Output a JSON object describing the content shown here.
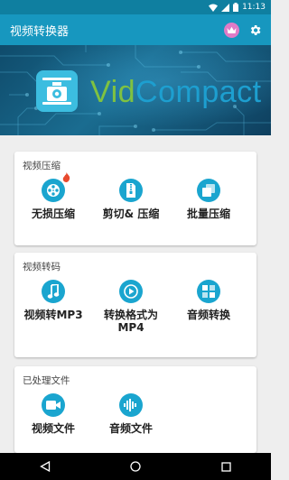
{
  "status_bar": {
    "time": "11:13"
  },
  "app_bar": {
    "title": "视频转换器"
  },
  "banner": {
    "brand_part1": "Vid",
    "brand_part2": "Compact"
  },
  "sections": [
    {
      "title": "视频压缩",
      "items": [
        {
          "label": "无损压缩",
          "icon": "film-reel-icon",
          "badge": "flame-icon"
        },
        {
          "label": "剪切& 压缩",
          "icon": "zip-file-icon"
        },
        {
          "label": "批量压缩",
          "icon": "stacked-files-icon"
        }
      ]
    },
    {
      "title": "视频转码",
      "items": [
        {
          "label": "视频转MP3",
          "icon": "music-note-icon"
        },
        {
          "label": "转换格式为MP4",
          "icon": "play-icon"
        },
        {
          "label": "音频转换",
          "icon": "puzzle-icon"
        }
      ]
    },
    {
      "title": "已处理文件",
      "items": [
        {
          "label": "视频文件",
          "icon": "video-file-icon"
        },
        {
          "label": "音频文件",
          "icon": "audio-wave-icon"
        }
      ]
    }
  ],
  "colors": {
    "status_bar": "#0f7fa0",
    "app_bar": "#1797bf",
    "icon_circle": "#1aa5cf",
    "crown": "#e07bc7",
    "brand_green": "#7fc241",
    "brand_blue": "#1d9fd0"
  }
}
